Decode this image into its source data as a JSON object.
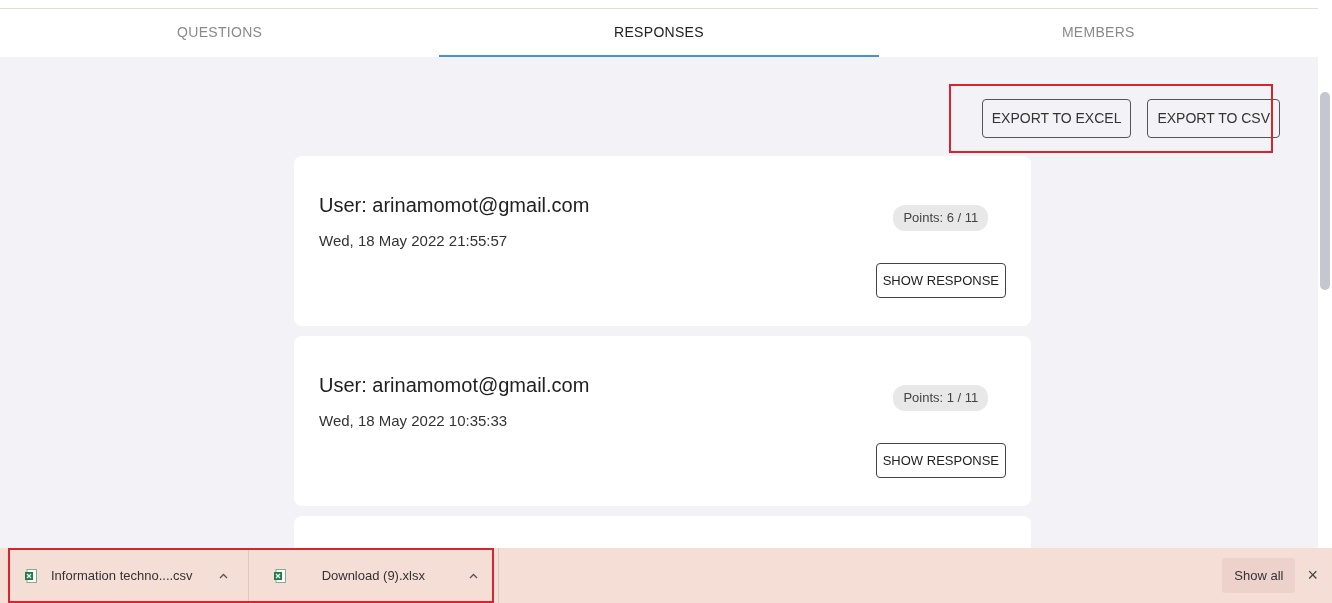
{
  "tabs": [
    {
      "label": "QUESTIONS",
      "selected": false
    },
    {
      "label": "RESPONSES",
      "selected": true
    },
    {
      "label": "MEMBERS",
      "selected": false
    }
  ],
  "export_buttons": [
    "EXPORT TO EXCEL",
    "EXPORT TO CSV"
  ],
  "responses": [
    {
      "user": "User: arinamomot@gmail.com",
      "date": "Wed, 18 May 2022 21:55:57",
      "points": "Points: 6 / 11",
      "button": "SHOW RESPONSE"
    },
    {
      "user": "User: arinamomot@gmail.com",
      "date": "Wed, 18 May 2022 10:35:33",
      "points": "Points: 1 / 11",
      "button": "SHOW RESPONSE"
    }
  ],
  "downloads": [
    {
      "file": "Information techno....csv"
    },
    {
      "file": "Download (9).xlsx"
    }
  ],
  "download_bar": {
    "show_all": "Show all",
    "close": "×"
  }
}
